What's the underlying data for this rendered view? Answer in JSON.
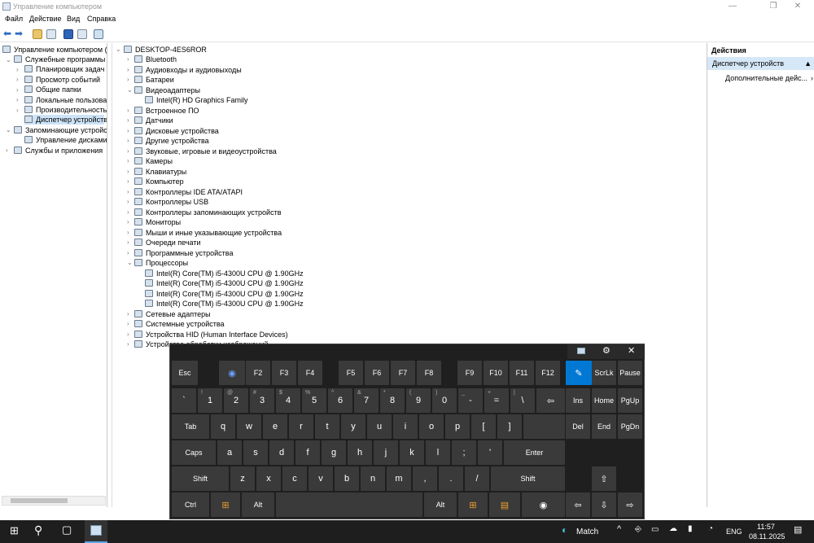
{
  "window": {
    "title": "Управление компьютером",
    "min": "—",
    "max": "❐",
    "close": "✕"
  },
  "menu": [
    "Файл",
    "Действие",
    "Вид",
    "Справка"
  ],
  "tree": {
    "root": "Управление компьютером (лс",
    "items": [
      "Служебные программы",
      "Планировщик задач",
      "Просмотр событий",
      "Общие папки",
      "Локальные пользовате",
      "Производительность",
      "Диспетчер устройств",
      "Запоминающие устройств",
      "Управление дисками",
      "Службы и приложения"
    ]
  },
  "devices": {
    "root": "DESKTOP-4ES6ROR",
    "items": [
      "Bluetooth",
      "Аудиовходы и аудиовыходы",
      "Батареи",
      "Видеоадаптеры",
      "Intel(R) HD Graphics Family",
      "Встроенное ПО",
      "Датчики",
      "Дисковые устройства",
      "Другие устройства",
      "Звуковые, игровые и видеоустройства",
      "Камеры",
      "Клавиатуры",
      "Компьютер",
      "Контроллеры IDE ATA/ATAPI",
      "Контроллеры USB",
      "Контроллеры запоминающих устройств",
      "Мониторы",
      "Мыши и иные указывающие устройства",
      "Очереди печати",
      "Программные устройства",
      "Процессоры",
      "Intel(R) Core(TM) i5-4300U CPU @ 1.90GHz",
      "Intel(R) Core(TM) i5-4300U CPU @ 1.90GHz",
      "Intel(R) Core(TM) i5-4300U CPU @ 1.90GHz",
      "Intel(R) Core(TM) i5-4300U CPU @ 1.90GHz",
      "Сетевые адаптеры",
      "Системные устройства",
      "Устройства HID (Human Interface Devices)",
      "Устройства обработки изображений"
    ]
  },
  "actions": {
    "header": "Действия",
    "active": "Диспетчер устройств",
    "more": "Дополнительные дейс..."
  },
  "keyboard": {
    "fn": [
      "Esc",
      "F2",
      "F3",
      "F4",
      "F5",
      "F6",
      "F7",
      "F8",
      "F9",
      "F10",
      "F11",
      "F12"
    ],
    "row1": [
      "`",
      "1",
      "2",
      "3",
      "4",
      "5",
      "6",
      "7",
      "8",
      "9",
      "0",
      "-",
      "=",
      "\\"
    ],
    "row1sub": [
      "",
      "!",
      "@",
      "#",
      "$",
      "%",
      "^",
      "&",
      "*",
      "(",
      ")",
      "_",
      "+",
      "|"
    ],
    "row2": [
      "Tab",
      "q",
      "w",
      "e",
      "r",
      "t",
      "y",
      "u",
      "i",
      "o",
      "p",
      "[",
      "]"
    ],
    "row3": [
      "Caps",
      "a",
      "s",
      "d",
      "f",
      "g",
      "h",
      "j",
      "k",
      "l",
      ";",
      "'",
      "Enter"
    ],
    "row4": [
      "Shift",
      "z",
      "x",
      "c",
      "v",
      "b",
      "n",
      "m",
      ",",
      ".",
      "/",
      "Shift"
    ],
    "row5": [
      "Ctrl",
      "Alt",
      "Alt",
      "Ctrl"
    ],
    "nav": [
      "ScrLk",
      "Pause",
      "Ins",
      "Home",
      "PgUp",
      "Del",
      "End",
      "PgDn"
    ]
  },
  "taskbar": {
    "weather": "Match",
    "lang": "ENG",
    "time": "11:57",
    "date": "08.11.2025"
  }
}
